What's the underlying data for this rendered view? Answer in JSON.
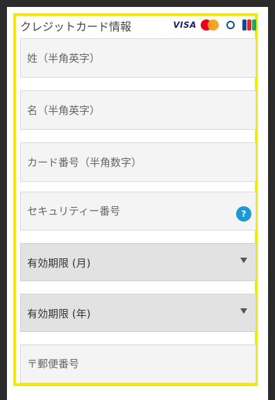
{
  "header": {
    "title": "クレジットカード情報",
    "cards": [
      {
        "name": "visa-logo",
        "label": "VISA"
      },
      {
        "name": "mastercard-logo",
        "label": ""
      },
      {
        "name": "diners-logo",
        "label": ""
      },
      {
        "name": "jcb-logo",
        "label": ""
      }
    ]
  },
  "form": {
    "last_name": {
      "placeholder": "姓（半角英字）",
      "value": ""
    },
    "first_name": {
      "placeholder": "名（半角英字）",
      "value": ""
    },
    "card_number": {
      "placeholder": "カード番号（半角数字）",
      "value": ""
    },
    "security_code": {
      "placeholder": "セキュリティー番号",
      "value": "",
      "help": "?"
    },
    "expiry_month": {
      "label": "有効期限 (月)"
    },
    "expiry_year": {
      "label": "有効期限 (年)"
    },
    "postal_code": {
      "placeholder": "〒郵便番号",
      "value": ""
    }
  },
  "colors": {
    "frame": "#f2ea00",
    "help": "#1a9ad0",
    "background": "#2b2b2b"
  }
}
